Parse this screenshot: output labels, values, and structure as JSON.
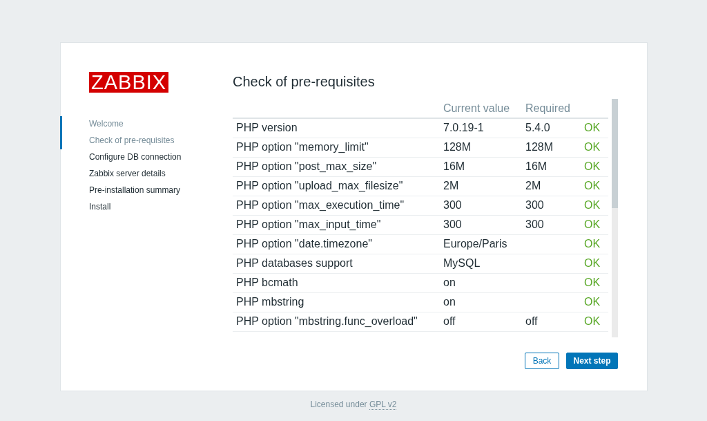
{
  "logo": "ZABBIX",
  "steps": [
    {
      "label": "Welcome",
      "done": true
    },
    {
      "label": "Check of pre-requisites",
      "done": true
    },
    {
      "label": "Configure DB connection",
      "done": false
    },
    {
      "label": "Zabbix server details",
      "done": false
    },
    {
      "label": "Pre-installation summary",
      "done": false
    },
    {
      "label": "Install",
      "done": false
    }
  ],
  "title": "Check of pre-requisites",
  "table": {
    "columns": [
      "Current value",
      "Required"
    ],
    "rows": [
      {
        "name": "PHP version",
        "current": "7.0.19-1",
        "required": "5.4.0",
        "status": "OK",
        "passed": true
      },
      {
        "name": "PHP option \"memory_limit\"",
        "current": "128M",
        "required": "128M",
        "status": "OK",
        "passed": true
      },
      {
        "name": "PHP option \"post_max_size\"",
        "current": "16M",
        "required": "16M",
        "status": "OK",
        "passed": true
      },
      {
        "name": "PHP option \"upload_max_filesize\"",
        "current": "2M",
        "required": "2M",
        "status": "OK",
        "passed": true
      },
      {
        "name": "PHP option \"max_execution_time\"",
        "current": "300",
        "required": "300",
        "status": "OK",
        "passed": true
      },
      {
        "name": "PHP option \"max_input_time\"",
        "current": "300",
        "required": "300",
        "status": "OK",
        "passed": true
      },
      {
        "name": "PHP option \"date.timezone\"",
        "current": "Europe/Paris",
        "status": "OK",
        "passed": true
      },
      {
        "name": "PHP databases support",
        "current": "MySQL",
        "status": "OK",
        "passed": true
      },
      {
        "name": "PHP bcmath",
        "current": "on",
        "status": "OK",
        "passed": true
      },
      {
        "name": "PHP mbstring",
        "current": "on",
        "status": "OK",
        "passed": true
      },
      {
        "name": "PHP option \"mbstring.func_overload\"",
        "current": "off",
        "required": "off",
        "status": "OK",
        "passed": true
      }
    ]
  },
  "buttons": {
    "back": "Back",
    "next": "Next step"
  },
  "footer": {
    "text": "Licensed under",
    "link": "GPL v2"
  }
}
